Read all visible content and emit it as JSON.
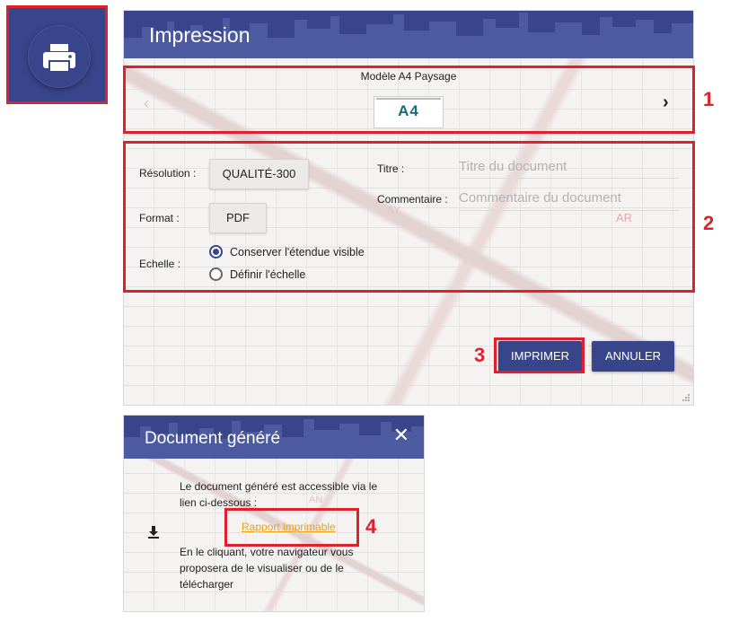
{
  "print_tile": {
    "icon": "printer-icon"
  },
  "impression": {
    "title": "Impression",
    "model": {
      "label": "Modèle A4 Paysage",
      "thumbnail_text": "A4",
      "prev_icon": "chevron-left-icon",
      "next_icon": "chevron-right-icon"
    },
    "resolution": {
      "label": "Résolution :",
      "value": "QUALITÉ-300"
    },
    "format": {
      "label": "Format :",
      "value": "PDF"
    },
    "echelle": {
      "label": "Echelle :",
      "options": [
        {
          "label": "Conserver l'étendue visible",
          "selected": true
        },
        {
          "label": "Définir l'échelle",
          "selected": false
        }
      ]
    },
    "titre": {
      "label": "Titre :",
      "placeholder": "Titre du document"
    },
    "commentaire": {
      "label": "Commentaire :",
      "placeholder": "Commentaire du document"
    },
    "print_button": "IMPRIMER",
    "cancel_button": "ANNULER"
  },
  "document": {
    "title": "Document généré",
    "close_icon": "close-icon",
    "text1": "Le document généré est accessible via le lien ci-dessous :",
    "link": "Rapport imprimable",
    "text2": "En le cliquant, votre navigateur vous proposera de le visualiser ou de le télécharger",
    "download_icon": "download-icon",
    "map_labels": [
      "AN"
    ]
  },
  "map_labels": [
    "AR",
    "AY"
  ],
  "annotations": [
    "1",
    "2",
    "3",
    "4"
  ],
  "colors": {
    "navy": "#38458b",
    "red": "#e0202c",
    "link": "#e8a317"
  }
}
